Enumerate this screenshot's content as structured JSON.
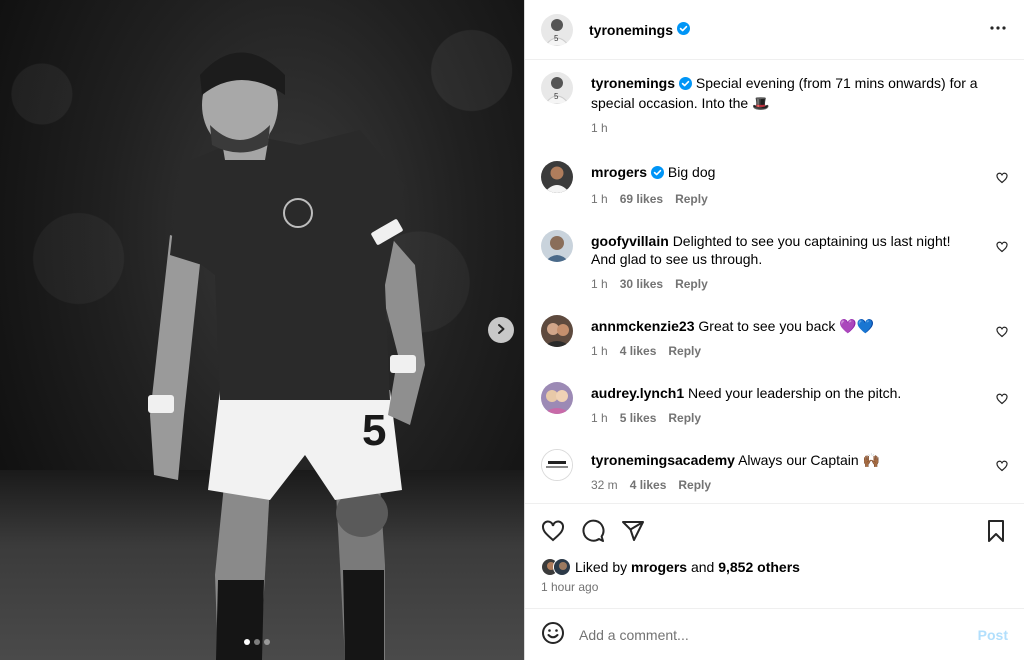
{
  "post": {
    "author": "tyronemings",
    "caption": "Special evening (from 71 mins onwards) for a special occasion. Into the 🎩",
    "caption_time": "1 h",
    "shirt_number": "5"
  },
  "comments": [
    {
      "user": "mrogers",
      "verified": true,
      "text": "Big dog",
      "time": "1 h",
      "likes": "69 likes",
      "reply": "Reply"
    },
    {
      "user": "goofyvillain",
      "verified": false,
      "text": "Delighted to see you captaining us last night! And glad to see us through.",
      "time": "1 h",
      "likes": "30 likes",
      "reply": "Reply"
    },
    {
      "user": "annmckenzie23",
      "verified": false,
      "text": "Great to see you back 💜💙",
      "time": "1 h",
      "likes": "4 likes",
      "reply": "Reply"
    },
    {
      "user": "audrey.lynch1",
      "verified": false,
      "text": "Need your leadership on the pitch.",
      "time": "1 h",
      "likes": "5 likes",
      "reply": "Reply"
    },
    {
      "user": "tyronemingsacademy",
      "verified": false,
      "text": "Always our Captain 🙌🏾",
      "time": "32 m",
      "likes": "4 likes",
      "reply": "Reply"
    }
  ],
  "likes": {
    "prefix": "Liked by",
    "user": "mrogers",
    "and": "and",
    "others": "9,852 others",
    "time_ago": "1 hour ago"
  },
  "add_comment": {
    "placeholder": "Add a comment...",
    "post_label": "Post"
  },
  "carousel": {
    "count": 3,
    "active": 0
  },
  "colors": {
    "verified": "#0095f6",
    "post_disabled": "#b2dffc",
    "meta": "#737373"
  },
  "icons": [
    "verified-badge-icon",
    "more-options-icon",
    "heart-icon",
    "comment-icon",
    "share-icon",
    "bookmark-icon",
    "emoji-icon",
    "chevron-right-icon"
  ]
}
